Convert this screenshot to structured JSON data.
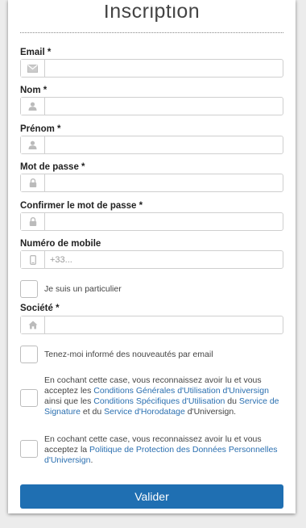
{
  "form": {
    "title": "Inscription",
    "email": {
      "label": "Email *",
      "value": "",
      "placeholder": ""
    },
    "nom": {
      "label": "Nom *",
      "value": "",
      "placeholder": ""
    },
    "prenom": {
      "label": "Prénom *",
      "value": "",
      "placeholder": ""
    },
    "password": {
      "label": "Mot de passe *",
      "value": "",
      "placeholder": ""
    },
    "password_confirm": {
      "label": "Confirmer le mot de passe *",
      "value": "",
      "placeholder": ""
    },
    "mobile": {
      "label": "Numéro de mobile",
      "value": "",
      "placeholder": "+33..."
    },
    "particulier": {
      "label": "Je suis un particulier",
      "checked": false
    },
    "societe": {
      "label": "Société *",
      "value": "",
      "placeholder": ""
    },
    "newsletter": {
      "label": "Tenez-moi informé des nouveautés par email",
      "checked": false
    },
    "cgu": {
      "checked": false,
      "t1": "En cochant cette case, vous reconnaissez avoir lu et vous acceptez les ",
      "l1": "Conditions Générales d'Utilisation d'Universign",
      "t2": " ainsi que les ",
      "l2": "Conditions Spécifiques d'Utilisation",
      "t3": " du ",
      "l3": "Service de Signature",
      "t4": " et du ",
      "l4": "Service d'Horodatage",
      "t5": " d'Universign."
    },
    "privacy": {
      "checked": false,
      "t1": "En cochant cette case, vous reconnaissez avoir lu et vous acceptez la ",
      "l1": "Politique de Protection des Données Personnelles d'Universign",
      "t2": "."
    },
    "submit_label": "Valider"
  },
  "icons": {
    "email": "envelope-icon",
    "nom": "user-icon",
    "prenom": "user-icon",
    "password": "lock-icon",
    "password_confirm": "lock-icon",
    "mobile": "mobile-icon",
    "societe": "home-icon"
  },
  "colors": {
    "accent": "#1f6fb2",
    "link": "#2a6fb0"
  }
}
